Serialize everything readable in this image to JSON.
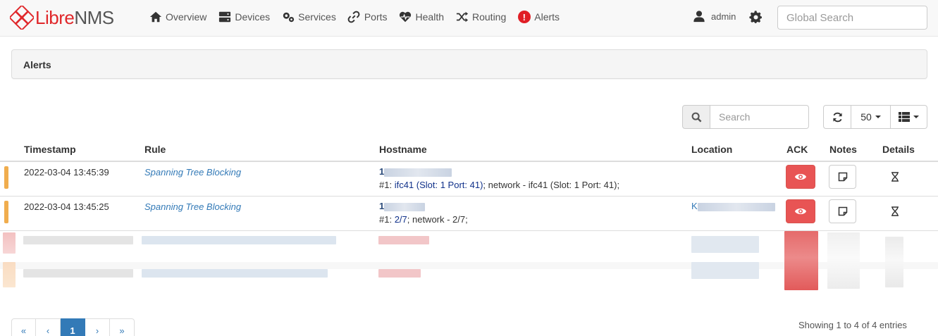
{
  "brand": {
    "libre": "Libre",
    "nms": "NMS",
    "color": "#e0282b"
  },
  "nav": [
    {
      "label": "Overview",
      "icon": "home-icon"
    },
    {
      "label": "Devices",
      "icon": "server-icon"
    },
    {
      "label": "Services",
      "icon": "cogs-icon"
    },
    {
      "label": "Ports",
      "icon": "link-icon"
    },
    {
      "label": "Health",
      "icon": "heartbeat-icon"
    },
    {
      "label": "Routing",
      "icon": "random-icon"
    },
    {
      "label": "Alerts",
      "icon": "exclamation-circle-icon"
    }
  ],
  "user": {
    "name": "admin"
  },
  "global_search": {
    "placeholder": "Global Search"
  },
  "panel": {
    "title": "Alerts"
  },
  "toolbar": {
    "search_placeholder": "Search",
    "page_size": "50"
  },
  "table": {
    "columns": [
      "Timestamp",
      "Rule",
      "Hostname",
      "Location",
      "ACK",
      "Notes",
      "Details"
    ],
    "rows": [
      {
        "timestamp": "2022-03-04 13:45:39",
        "rule": "Spanning Tree Blocking",
        "host_prefix": "1",
        "detail_prefix": "#1: ",
        "detail_link": "ifc41 (Slot: 1 Port: 41)",
        "detail_suffix": ";  network - ifc41 (Slot: 1 Port: 41);",
        "location_prefix": "",
        "severity_color": "#f0ad4e"
      },
      {
        "timestamp": "2022-03-04 13:45:25",
        "rule": "Spanning Tree Blocking",
        "host_prefix": "1",
        "detail_prefix": "#1: ",
        "detail_link": "2/7",
        "detail_suffix": ";  network - 2/7;",
        "location_prefix": "K",
        "severity_color": "#f0ad4e"
      }
    ]
  },
  "pagination": {
    "first": "«",
    "prev": "‹",
    "current": "1",
    "next": "›",
    "last": "»"
  },
  "footer": {
    "showing": "Showing 1 to 4 of 4 entries"
  }
}
